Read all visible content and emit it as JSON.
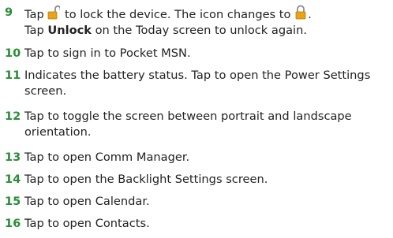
{
  "items": [
    {
      "number": "9",
      "line1": {
        "before": "Tap ",
        "icon1": "unlocked-padlock-icon",
        "mid": " to lock the device. The icon changes to ",
        "icon2": "locked-padlock-icon",
        "after": "."
      },
      "line2": {
        "before": "Tap ",
        "bold": "Unlock",
        "after": " on the Today screen to unlock again."
      }
    },
    {
      "number": "10",
      "text": "Tap to sign in to Pocket MSN."
    },
    {
      "number": "11",
      "line1": "Indicates the battery status. Tap to open the Power Settings",
      "line2": "screen."
    },
    {
      "number": "12",
      "line1": "Tap to toggle the screen between portrait and landscape",
      "line2": "orientation."
    },
    {
      "number": "13",
      "text": "Tap to open Comm Manager."
    },
    {
      "number": "14",
      "text": "Tap to open the Backlight Settings screen."
    },
    {
      "number": "15",
      "text": "Tap to open Calendar."
    },
    {
      "number": "16",
      "text": "Tap to open Contacts."
    }
  ],
  "colors": {
    "number": "#2a8d3a",
    "text": "#222222",
    "icon_body": "#e8a316",
    "icon_shackle": "#8a8a8a"
  }
}
